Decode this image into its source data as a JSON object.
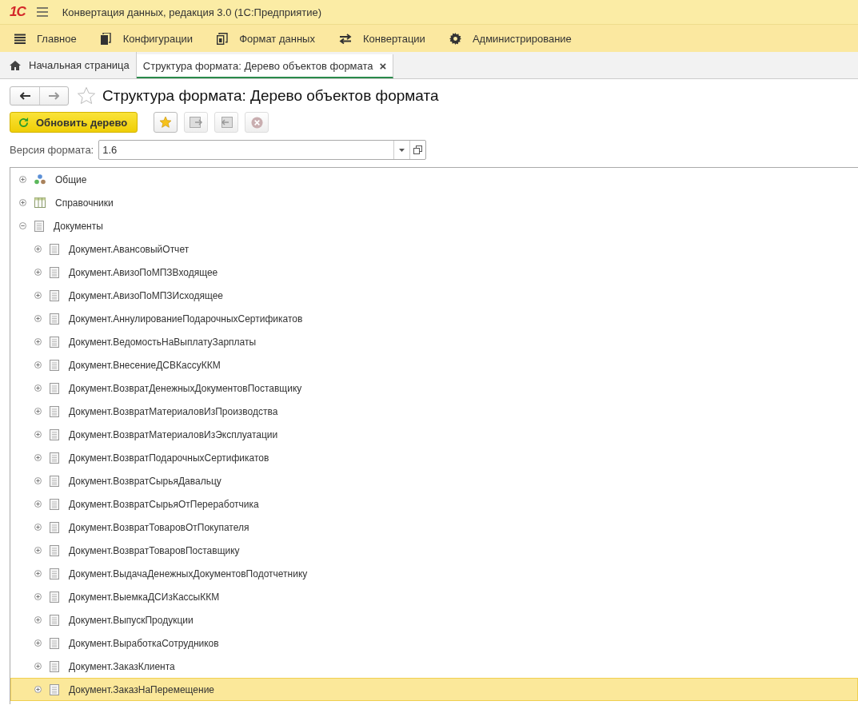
{
  "window": {
    "logo": "1С",
    "title": "Конвертация данных, редакция 3.0  (1С:Предприятие)"
  },
  "sections": [
    {
      "kind": "menu",
      "label": "Главное"
    },
    {
      "kind": "config",
      "label": "Конфигурации"
    },
    {
      "kind": "format",
      "label": "Формат данных"
    },
    {
      "kind": "convert",
      "label": "Конвертации"
    },
    {
      "kind": "gear",
      "label": "Администрирование"
    }
  ],
  "tabs": [
    {
      "kind": "home",
      "label": "Начальная страница",
      "selected": false
    },
    {
      "kind": "doc",
      "label": "Структура формата: Дерево объектов формата",
      "selected": true,
      "close": "×"
    }
  ],
  "form": {
    "title": "Структура формата: Дерево объектов формата",
    "refresh_button": "Обновить дерево",
    "version_label": "Версия формата:",
    "version_value": "1.6"
  },
  "tree": [
    {
      "kind": "common",
      "label": "Общие",
      "expanded": false,
      "selected": false
    },
    {
      "kind": "catalogs",
      "label": "Справочники",
      "expanded": false,
      "selected": false
    },
    {
      "kind": "documents",
      "label": "Документы",
      "expanded": true,
      "selected": false,
      "children": [
        {
          "kind": "document",
          "label": "Документ.АвансовыйОтчет",
          "expanded": false,
          "selected": false
        },
        {
          "kind": "document",
          "label": "Документ.АвизоПоМПЗВходящее",
          "expanded": false,
          "selected": false
        },
        {
          "kind": "document",
          "label": "Документ.АвизоПоМПЗИсходящее",
          "expanded": false,
          "selected": false
        },
        {
          "kind": "document",
          "label": "Документ.АннулированиеПодарочныхСертификатов",
          "expanded": false,
          "selected": false
        },
        {
          "kind": "document",
          "label": "Документ.ВедомостьНаВыплатуЗарплаты",
          "expanded": false,
          "selected": false
        },
        {
          "kind": "document",
          "label": "Документ.ВнесениеДСВКассуККМ",
          "expanded": false,
          "selected": false
        },
        {
          "kind": "document",
          "label": "Документ.ВозвратДенежныхДокументовПоставщику",
          "expanded": false,
          "selected": false
        },
        {
          "kind": "document",
          "label": "Документ.ВозвратМатериаловИзПроизводства",
          "expanded": false,
          "selected": false
        },
        {
          "kind": "document",
          "label": "Документ.ВозвратМатериаловИзЭксплуатации",
          "expanded": false,
          "selected": false
        },
        {
          "kind": "document",
          "label": "Документ.ВозвратПодарочныхСертификатов",
          "expanded": false,
          "selected": false
        },
        {
          "kind": "document",
          "label": "Документ.ВозвратСырьяДавальцу",
          "expanded": false,
          "selected": false
        },
        {
          "kind": "document",
          "label": "Документ.ВозвратСырьяОтПереработчика",
          "expanded": false,
          "selected": false
        },
        {
          "kind": "document",
          "label": "Документ.ВозвратТоваровОтПокупателя",
          "expanded": false,
          "selected": false
        },
        {
          "kind": "document",
          "label": "Документ.ВозвратТоваровПоставщику",
          "expanded": false,
          "selected": false
        },
        {
          "kind": "document",
          "label": "Документ.ВыдачаДенежныхДокументовПодотчетнику",
          "expanded": false,
          "selected": false
        },
        {
          "kind": "document",
          "label": "Документ.ВыемкаДСИзКассыККМ",
          "expanded": false,
          "selected": false
        },
        {
          "kind": "document",
          "label": "Документ.ВыпускПродукции",
          "expanded": false,
          "selected": false
        },
        {
          "kind": "document",
          "label": "Документ.ВыработкаСотрудников",
          "expanded": false,
          "selected": false
        },
        {
          "kind": "document",
          "label": "Документ.ЗаказКлиента",
          "expanded": false,
          "selected": false
        },
        {
          "kind": "document",
          "label": "Документ.ЗаказНаПеремещение",
          "expanded": false,
          "selected": true
        }
      ]
    }
  ]
}
